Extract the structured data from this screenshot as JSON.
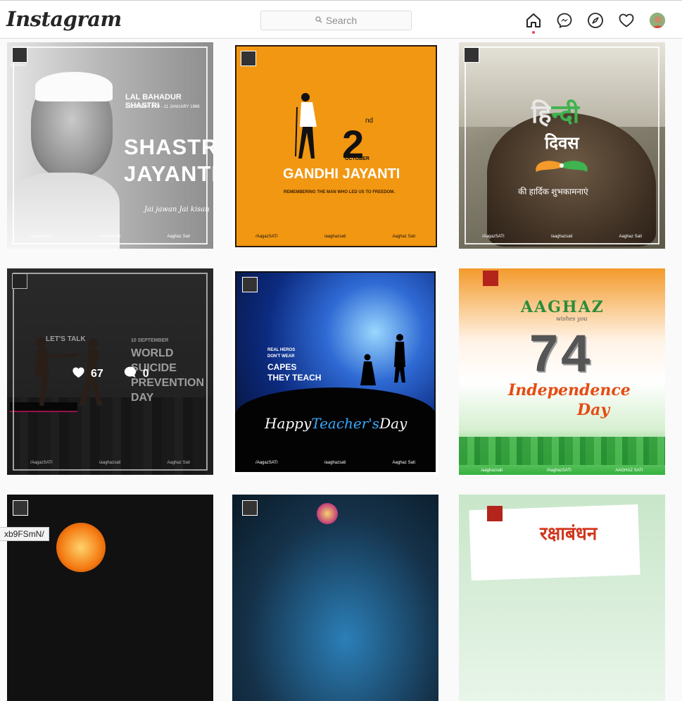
{
  "header": {
    "logo": "Instagram",
    "search_placeholder": "Search"
  },
  "nav_icons": [
    "home-icon",
    "messenger-icon",
    "explore-icon",
    "activity-heart-icon",
    "avatar"
  ],
  "colors": {
    "notification_dot": "#ed4956",
    "border": "#dbdbdb",
    "background": "#fafafa"
  },
  "brand_mark": "AAGHAZ",
  "posts": [
    {
      "small_title": "LAL BAHADUR SHASTRI",
      "dates": "2 OCTOBER 1904 - 11 JANUARY 1966",
      "big_line1": "SHASTRI",
      "big_line2": "JAYANTI",
      "slogan": "Jai jawan Jai kisan",
      "social": [
        "/AagazSATI",
        "/aaghazsati",
        "Aaghaz Sati"
      ]
    },
    {
      "number": "2",
      "suffix": "nd",
      "month": "OCTOBER",
      "title": "GANDHI JAYANTI",
      "subtitle": "REMEMBERING THE MAN WHO LED US TO FREEDOM.",
      "social": [
        "/AagazSATI",
        "/aaghazsati",
        "Aaghaz Sati"
      ]
    },
    {
      "line1_a": "हि",
      "line1_b": "न्दी",
      "line2": "दिवस",
      "wish": "की हार्दिक शुभकामनाएं",
      "social": [
        "/AagazSATI",
        "/aaghazsati",
        "Aaghaz Sati"
      ]
    },
    {
      "talk": "LET'S TALK",
      "date": "10 SEPTEMBER",
      "line1": "WORLD",
      "line2": "SUICIDE",
      "line3": "PREVENTION",
      "line4": "DAY",
      "likes": "67",
      "comments": "0",
      "social": [
        "/AagazSATI",
        "/aaghazsati",
        "Aaghaz Sati"
      ]
    },
    {
      "tag1": "REAL HEROS",
      "tag2": "DON'T WEAR",
      "capes1": "CAPES",
      "capes2": "THEY TEACH",
      "happy_a": "Happy",
      "happy_b": "Teacher's",
      "happy_c": "Day",
      "social": [
        "/AagazSATI",
        "/aaghazsati",
        "Aaghaz Sati"
      ]
    },
    {
      "brand": "AAGHAZ",
      "wishes": "wishes you",
      "number": "74",
      "line1": "Independence",
      "line2": "Day",
      "social": [
        "/aaghazsati",
        "/AaghazSATI",
        "AAGHAZ SATI"
      ]
    },
    {},
    {},
    {
      "title": "रक्षाबंधन"
    }
  ],
  "status_url": "xb9FSmN/"
}
